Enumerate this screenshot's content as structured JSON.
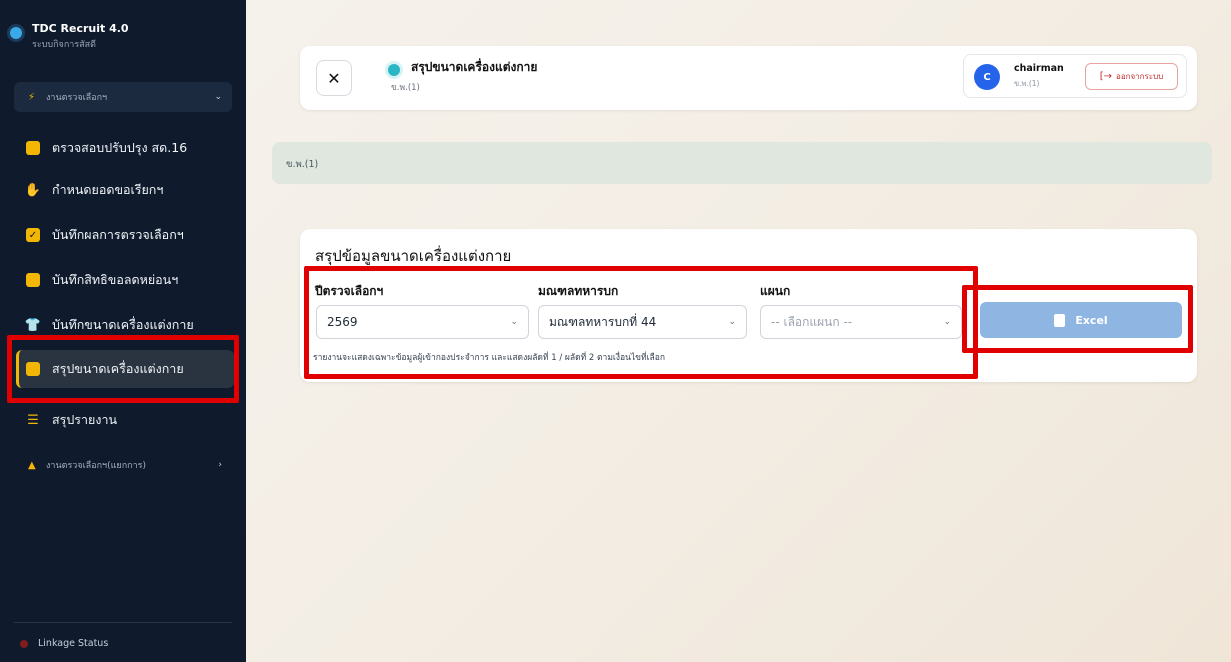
{
  "app": {
    "title": "TDC Recruit 4.0",
    "subtitle": "ระบบกิจการสัสดี"
  },
  "sidebar": {
    "section_main": "งานตรวจเลือกฯ",
    "items": [
      {
        "label": "ตรวจสอบปรับปรุง สด.16"
      },
      {
        "label": "กำหนดยอดขอเรียกฯ"
      },
      {
        "label": "บันทึกผลการตรวจเลือกฯ"
      },
      {
        "label": "บันทึกสิทธิขอลดหย่อนฯ"
      },
      {
        "label": "บันทึกขนาดเครื่องแต่งกาย"
      },
      {
        "label": "สรุปขนาดเครื่องแต่งกาย"
      },
      {
        "label": "สรุปรายงาน"
      }
    ],
    "section_secondary": "งานตรวจเลือกฯ(แยกการ)",
    "linkage_status": "Linkage Status"
  },
  "header": {
    "title": "สรุปขนาดเครื่องแต่งกาย",
    "subtitle": "ข.พ.(1)",
    "user": {
      "initial": "C",
      "name": "chairman",
      "role": "ข.พ.(1)"
    },
    "logout_label": "ออกจากระบบ"
  },
  "crumb": "ข.พ.(1)",
  "card": {
    "title": "สรุปข้อมูลขนาดเครื่องแต่งกาย",
    "fields": {
      "year": {
        "label": "ปีตรวจเลือกฯ",
        "value": "2569"
      },
      "circle": {
        "label": "มณฑลทหารบก",
        "value": "มณฑลทหารบกที่ 44"
      },
      "department": {
        "label": "แผนก",
        "placeholder": "-- เลือกแผนก --"
      }
    },
    "note": "รายงานจะแสดงเฉพาะข้อมูลผู้เข้ากองประจำการ และแสดงผลัดที่ 1 / ผลัดที่ 2 ตามเงื่อนไขที่เลือก",
    "excel_label": "Excel"
  },
  "colors": {
    "sidebar_bg": "#0f1b2d",
    "active_accent": "#f2b705",
    "excel_button": "#8fb6e3",
    "highlight": "#e10000"
  },
  "icons": {
    "close": "close-icon",
    "logout": "logout-icon",
    "excel": "excel-file-icon"
  }
}
